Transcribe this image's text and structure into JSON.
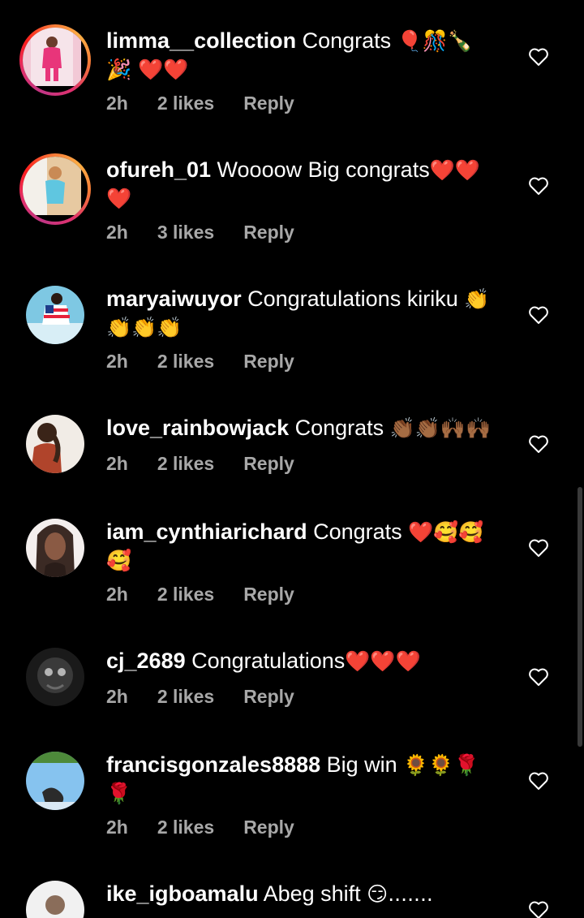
{
  "comments": [
    {
      "username": "limma__collection",
      "text": " Congrats ",
      "emoji": "🎈🎊🍾 🎉 ❤️❤️",
      "time": "2h",
      "likes": "2 likes",
      "reply": "Reply",
      "avatar_colors": [
        "#f2c9d6",
        "#e8357a",
        "#ffffff"
      ]
    },
    {
      "username": "ofureh_01",
      "text": " Woooow Big congrats",
      "emoji": "❤️❤️ ❤️",
      "time": "2h",
      "likes": "3 likes",
      "reply": "Reply",
      "avatar_colors": [
        "#e7c9a1",
        "#5fc6e0",
        "#f3f0ea"
      ]
    },
    {
      "username": "maryaiwuyor",
      "text": " Congratulations kiriku ",
      "emoji": "👏 👏👏👏",
      "time": "2h",
      "likes": "2 likes",
      "reply": "Reply",
      "avatar_colors": [
        "#7ec8e3",
        "#e6213a",
        "#ffffff"
      ]
    },
    {
      "username": "love_rainbowjack",
      "text": " Congrats ",
      "emoji": "👏🏾👏🏾🙌🏾🙌🏾",
      "time": "2h",
      "likes": "2 likes",
      "reply": "Reply",
      "avatar_colors": [
        "#f1ece6",
        "#b0442b",
        "#3a2418"
      ]
    },
    {
      "username": "iam_cynthiarichard",
      "text": " Congrats ",
      "emoji": "❤️🥰🥰 🥰",
      "time": "2h",
      "likes": "2 likes",
      "reply": "Reply",
      "avatar_colors": [
        "#f4efee",
        "#3b2a24",
        "#8a5a44"
      ]
    },
    {
      "username": "cj_2689",
      "text": " Congratulations",
      "emoji": "❤️❤️❤️",
      "time": "2h",
      "likes": "2 likes",
      "reply": "Reply",
      "avatar_colors": [
        "#1a1a1a",
        "#6a6a6a",
        "#b5b5b5"
      ]
    },
    {
      "username": "francisgonzales8888",
      "text": " Big win ",
      "emoji": "🌻🌻🌹 🌹",
      "time": "2h",
      "likes": "2 likes",
      "reply": "Reply",
      "avatar_colors": [
        "#86c3ef",
        "#4d8a3a",
        "#2b2b2b"
      ]
    },
    {
      "username": "ike_igboamalu",
      "text": " Abeg shift ",
      "emoji": "😏.......",
      "time": "",
      "likes": "",
      "reply": "",
      "avatar_colors": [
        "#f1f1f1",
        "#8a6d5a",
        "#dddddd"
      ]
    }
  ],
  "icons": {
    "like": "heart-outline-icon"
  },
  "colors": {
    "background": "#000000",
    "text": "#ffffff",
    "meta": "#a8a8a8"
  }
}
